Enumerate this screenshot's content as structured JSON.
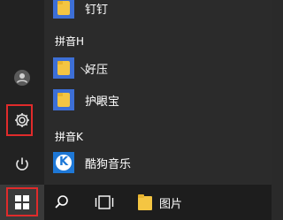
{
  "apps": {
    "top_item": {
      "label": "钉钉"
    },
    "section_h": "拼音H",
    "haoya": {
      "label": "好压"
    },
    "huyanbao": {
      "label": "护眼宝"
    },
    "section_k": "拼音K",
    "kugou": {
      "label": "酷狗音乐",
      "glyph": "K"
    }
  },
  "taskbar": {
    "pictures_label": "图片"
  },
  "colors": {
    "highlight": "#e02b2b",
    "tile_blue": "#1e78d7",
    "folder_yellow": "#f4c542"
  },
  "icons": [
    "user-icon",
    "gear-icon",
    "power-icon",
    "windows-logo-icon",
    "search-icon",
    "task-view-icon",
    "folder-icon"
  ]
}
